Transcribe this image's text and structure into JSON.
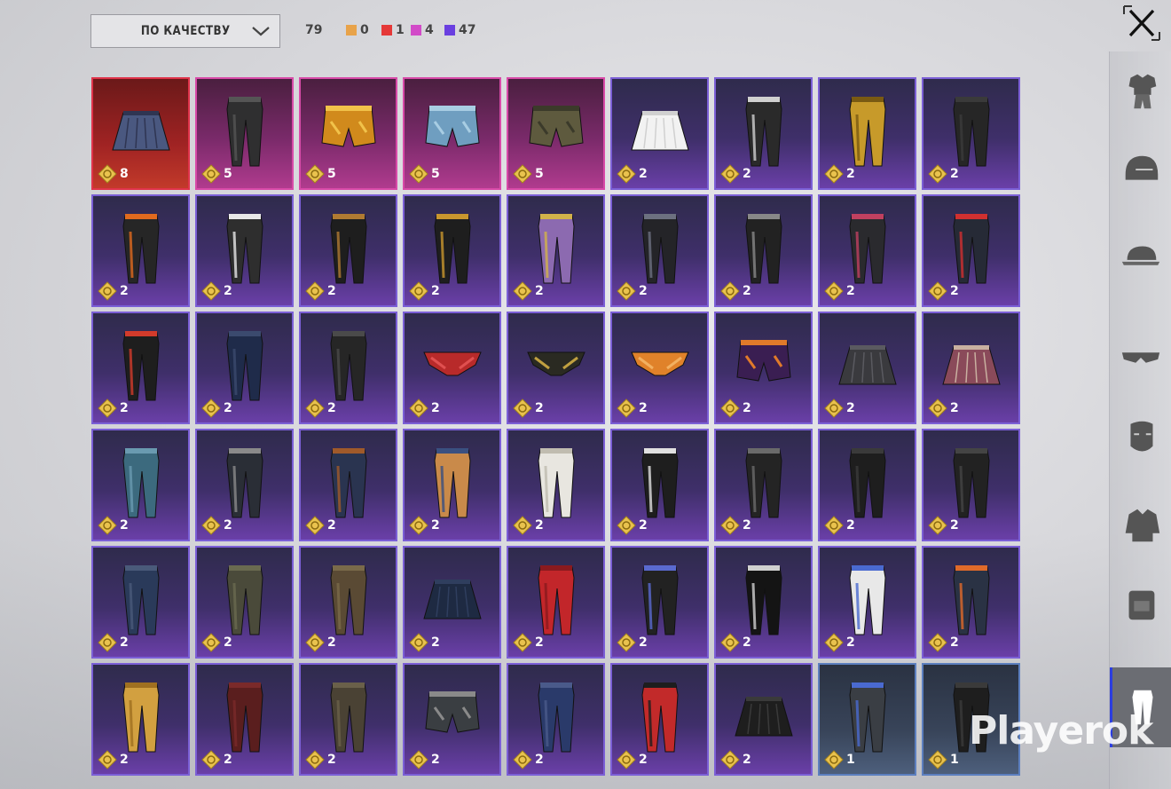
{
  "sort": {
    "label": "ПО КАЧЕСТВУ"
  },
  "summary": {
    "total": "79",
    "rarities": [
      {
        "name": "legendary",
        "color": "#e8a34a",
        "count": "0"
      },
      {
        "name": "mythic",
        "color": "#e53838",
        "count": "1"
      },
      {
        "name": "epic",
        "color": "#d24bc8",
        "count": "4"
      },
      {
        "name": "rare",
        "color": "#6a3fe0",
        "count": "47"
      }
    ]
  },
  "items": [
    {
      "kind": "skirt",
      "quality": "red",
      "count": "8",
      "color": "#4a5880",
      "accent": "#2f3552"
    },
    {
      "kind": "pants",
      "quality": "pink",
      "count": "5",
      "color": "#2f2f30",
      "accent": "#555"
    },
    {
      "kind": "shorts",
      "quality": "pink",
      "count": "5",
      "color": "#d18a1c",
      "accent": "#f1c24a"
    },
    {
      "kind": "shorts",
      "quality": "pink",
      "count": "5",
      "color": "#6f9ec0",
      "accent": "#a8cde3"
    },
    {
      "kind": "shorts",
      "quality": "pink",
      "count": "5",
      "color": "#5e5a3e",
      "accent": "#3b3a2a"
    },
    {
      "kind": "skirt",
      "quality": "purple",
      "count": "2",
      "color": "#f2f2f2",
      "accent": "#d0d0d0"
    },
    {
      "kind": "pants",
      "quality": "purple",
      "count": "2",
      "color": "#2a2a2a",
      "accent": "#d0d0d0"
    },
    {
      "kind": "pants",
      "quality": "purple",
      "count": "2",
      "color": "#c79a2a",
      "accent": "#7a5a12"
    },
    {
      "kind": "pants",
      "quality": "purple",
      "count": "2",
      "color": "#262626",
      "accent": "#3a3a3a"
    },
    {
      "kind": "pants",
      "quality": "purple",
      "count": "2",
      "color": "#262626",
      "accent": "#e06a1e"
    },
    {
      "kind": "pants",
      "quality": "purple",
      "count": "2",
      "color": "#2e2e2e",
      "accent": "#e8e8e8"
    },
    {
      "kind": "pants",
      "quality": "purple",
      "count": "2",
      "color": "#1e1e1e",
      "accent": "#b07a32"
    },
    {
      "kind": "pants",
      "quality": "purple",
      "count": "2",
      "color": "#1e1e1e",
      "accent": "#c9962e"
    },
    {
      "kind": "pants",
      "quality": "purple",
      "count": "2",
      "color": "#8c6ab0",
      "accent": "#d2b24a"
    },
    {
      "kind": "pants",
      "quality": "purple",
      "count": "2",
      "color": "#242428",
      "accent": "#6c7080"
    },
    {
      "kind": "pants",
      "quality": "purple",
      "count": "2",
      "color": "#222",
      "accent": "#888"
    },
    {
      "kind": "pants",
      "quality": "purple",
      "count": "2",
      "color": "#2a2a2e",
      "accent": "#c04060"
    },
    {
      "kind": "pants",
      "quality": "purple",
      "count": "2",
      "color": "#262a36",
      "accent": "#d03030"
    },
    {
      "kind": "pants",
      "quality": "purple",
      "count": "2",
      "color": "#1e1e1e",
      "accent": "#d23b2b"
    },
    {
      "kind": "pants",
      "quality": "purple",
      "count": "2",
      "color": "#1f2b4a",
      "accent": "#3b4a6e"
    },
    {
      "kind": "pants",
      "quality": "purple",
      "count": "2",
      "color": "#262626",
      "accent": "#4a4a4a"
    },
    {
      "kind": "briefs",
      "quality": "purple",
      "count": "2",
      "color": "#b82a2a",
      "accent": "#e05050"
    },
    {
      "kind": "briefs",
      "quality": "purple",
      "count": "2",
      "color": "#2a2a22",
      "accent": "#c0a040"
    },
    {
      "kind": "briefs",
      "quality": "purple",
      "count": "2",
      "color": "#e0822a",
      "accent": "#f2b060"
    },
    {
      "kind": "shorts",
      "quality": "purple",
      "count": "2",
      "color": "#3a1e52",
      "accent": "#e07a2a"
    },
    {
      "kind": "skirt",
      "quality": "purple",
      "count": "2",
      "color": "#3a3a3e",
      "accent": "#5a5a60"
    },
    {
      "kind": "skirt",
      "quality": "purple",
      "count": "2",
      "color": "#8a4a5a",
      "accent": "#c9b0a0"
    },
    {
      "kind": "pants",
      "quality": "purple",
      "count": "2",
      "color": "#3c6a7e",
      "accent": "#6a9ab0"
    },
    {
      "kind": "pants",
      "quality": "purple",
      "count": "2",
      "color": "#2a2e36",
      "accent": "#8a8a8a"
    },
    {
      "kind": "pants",
      "quality": "purple",
      "count": "2",
      "color": "#2a3450",
      "accent": "#a05a2a"
    },
    {
      "kind": "pants",
      "quality": "purple",
      "count": "2",
      "color": "#c98a4a",
      "accent": "#3a5080"
    },
    {
      "kind": "pants",
      "quality": "purple",
      "count": "2",
      "color": "#e8e6e0",
      "accent": "#c0bcb0"
    },
    {
      "kind": "pants",
      "quality": "purple",
      "count": "2",
      "color": "#1e1e1e",
      "accent": "#e0e0e0"
    },
    {
      "kind": "pants",
      "quality": "purple",
      "count": "2",
      "color": "#242424",
      "accent": "#6a6a6a"
    },
    {
      "kind": "pants",
      "quality": "purple",
      "count": "2",
      "color": "#1e1e1e",
      "accent": "#3a3a3a"
    },
    {
      "kind": "pants",
      "quality": "purple",
      "count": "2",
      "color": "#222",
      "accent": "#444"
    },
    {
      "kind": "pants",
      "quality": "purple",
      "count": "2",
      "color": "#2a3a5a",
      "accent": "#4a5a7a"
    },
    {
      "kind": "pants",
      "quality": "purple",
      "count": "2",
      "color": "#4a4a3a",
      "accent": "#6a6a50"
    },
    {
      "kind": "pants",
      "quality": "purple",
      "count": "2",
      "color": "#5a4a34",
      "accent": "#7a6a4a"
    },
    {
      "kind": "skirt",
      "quality": "purple",
      "count": "2",
      "color": "#1e2a42",
      "accent": "#2f3e5e"
    },
    {
      "kind": "pants",
      "quality": "purple",
      "count": "2",
      "color": "#c2262a",
      "accent": "#8a1a1e"
    },
    {
      "kind": "pants",
      "quality": "purple",
      "count": "2",
      "color": "#222",
      "accent": "#5a6ad0"
    },
    {
      "kind": "pants",
      "quality": "purple",
      "count": "2",
      "color": "#141414",
      "accent": "#d0d0d0"
    },
    {
      "kind": "pants",
      "quality": "purple",
      "count": "2",
      "color": "#e8e8e8",
      "accent": "#4a6ad0"
    },
    {
      "kind": "pants",
      "quality": "purple",
      "count": "2",
      "color": "#2a3244",
      "accent": "#e06a2a"
    },
    {
      "kind": "pants",
      "quality": "purple",
      "count": "2",
      "color": "#d2a040",
      "accent": "#a07020"
    },
    {
      "kind": "pants",
      "quality": "purple",
      "count": "2",
      "color": "#5a1e1e",
      "accent": "#7a2a2a"
    },
    {
      "kind": "pants",
      "quality": "purple",
      "count": "2",
      "color": "#4a4234",
      "accent": "#6a604a"
    },
    {
      "kind": "shorts",
      "quality": "purple",
      "count": "2",
      "color": "#3a3e42",
      "accent": "#8a8a8a"
    },
    {
      "kind": "pants",
      "quality": "purple",
      "count": "2",
      "color": "#2a3a6a",
      "accent": "#4a5a8a"
    },
    {
      "kind": "pants",
      "quality": "purple",
      "count": "2",
      "color": "#c22a2a",
      "accent": "#1e1e1e"
    },
    {
      "kind": "skirt",
      "quality": "purple",
      "count": "2",
      "color": "#1e1e1e",
      "accent": "#3a3a3a"
    },
    {
      "kind": "pants",
      "quality": "blue",
      "count": "1",
      "color": "#3a3e44",
      "accent": "#4a6ad0"
    },
    {
      "kind": "pants",
      "quality": "blue",
      "count": "1",
      "color": "#1e1e1e",
      "accent": "#3a3a3a"
    }
  ],
  "sidebar": [
    {
      "name": "outfit-icon"
    },
    {
      "name": "helmet-icon"
    },
    {
      "name": "cap-icon"
    },
    {
      "name": "glasses-icon"
    },
    {
      "name": "mask-icon"
    },
    {
      "name": "jacket-icon"
    },
    {
      "name": "backpack-icon"
    },
    {
      "name": "pants-icon",
      "active": true
    }
  ],
  "watermark": "Playerok",
  "colors": {
    "coin": "#e9c24e",
    "border_rare": "#7b5fd6",
    "active_tab": "#2b3de0"
  }
}
